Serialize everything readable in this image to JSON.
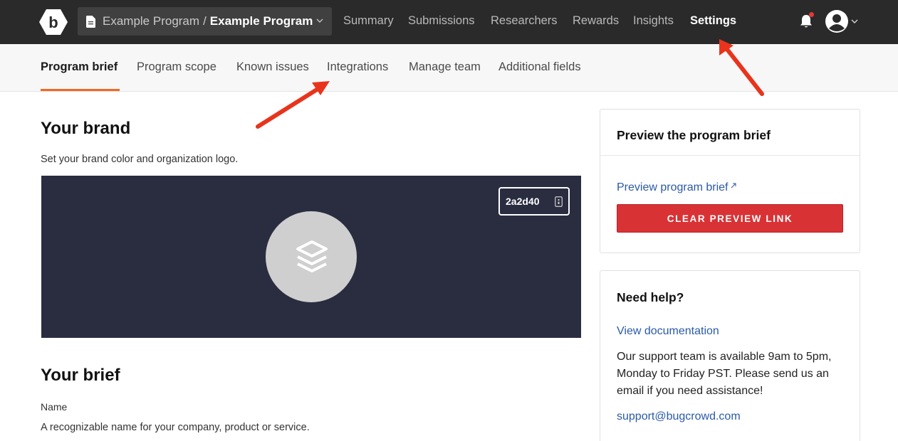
{
  "app": {
    "logo_icon": "bugcrowd-logo",
    "program_select": {
      "icon": "document-icon",
      "org": "Example Program",
      "separator": "/",
      "program": "Example Program"
    }
  },
  "topnav": {
    "items": [
      {
        "label": "Summary",
        "active": false
      },
      {
        "label": "Submissions",
        "active": false
      },
      {
        "label": "Researchers",
        "active": false
      },
      {
        "label": "Rewards",
        "active": false
      },
      {
        "label": "Insights",
        "active": false
      },
      {
        "label": "Settings",
        "active": true
      }
    ],
    "notification_dot_color": "#e53935"
  },
  "subnav": {
    "items": [
      {
        "label": "Program brief",
        "active": true
      },
      {
        "label": "Program scope",
        "active": false
      },
      {
        "label": "Known issues",
        "active": false
      },
      {
        "label": "Integrations",
        "active": false
      },
      {
        "label": "Manage team",
        "active": false
      },
      {
        "label": "Additional fields",
        "active": false
      }
    ],
    "active_color": "#f26822"
  },
  "brand": {
    "heading": "Your brand",
    "description": "Set your brand color and organization logo.",
    "color_hex": "2a2d40",
    "background_color": "#2a2d40"
  },
  "brief": {
    "heading": "Your brief",
    "name_label": "Name",
    "name_help": "A recognizable name for your company, product or service."
  },
  "preview_card": {
    "title": "Preview the program brief",
    "link": "Preview program brief",
    "button": "CLEAR PREVIEW LINK",
    "button_color": "#d93235"
  },
  "help_card": {
    "title": "Need help?",
    "doc_link": "View documentation",
    "support_text": "Our support team is available 9am to 5pm, Monday to Friday PST. Please send us an email if you need assistance!",
    "email": "support@bugcrowd.com"
  },
  "annotations": {
    "arrow_color": "#e8341c"
  }
}
